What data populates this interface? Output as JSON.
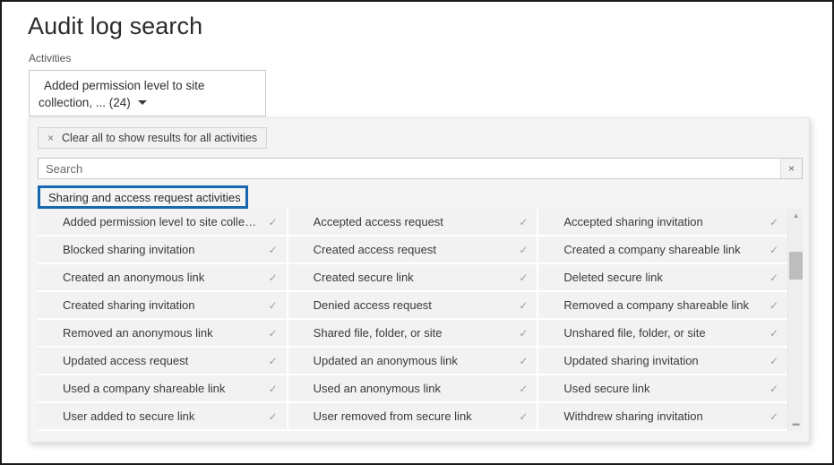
{
  "page": {
    "title": "Audit log search"
  },
  "activities_field": {
    "label": "Activities",
    "selected_line1": "Added permission level to site",
    "selected_line2": "collection, ... (24)",
    "caret_icon": "chevron-down-icon"
  },
  "panel": {
    "clear_all": {
      "x_icon": "close-icon",
      "label": "Clear all to show results for all activities"
    },
    "search": {
      "value": "",
      "placeholder": "Search",
      "clear_icon": "close-icon",
      "clear_label": "×"
    },
    "group_header": {
      "label": "Sharing and access request activities"
    },
    "check_glyph": "✓",
    "columns": [
      [
        {
          "label": "Added permission level to site collection",
          "selected": true
        },
        {
          "label": "Blocked sharing invitation",
          "selected": true
        },
        {
          "label": "Created an anonymous link",
          "selected": true
        },
        {
          "label": "Created sharing invitation",
          "selected": true
        },
        {
          "label": "Removed an anonymous link",
          "selected": true
        },
        {
          "label": "Updated access request",
          "selected": true
        },
        {
          "label": "Used a company shareable link",
          "selected": true
        },
        {
          "label": "User added to secure link",
          "selected": true
        }
      ],
      [
        {
          "label": "Accepted access request",
          "selected": true
        },
        {
          "label": "Created access request",
          "selected": true
        },
        {
          "label": "Created secure link",
          "selected": true
        },
        {
          "label": "Denied access request",
          "selected": true
        },
        {
          "label": "Shared file, folder, or site",
          "selected": true
        },
        {
          "label": "Updated an anonymous link",
          "selected": true
        },
        {
          "label": "Used an anonymous link",
          "selected": true
        },
        {
          "label": "User removed from secure link",
          "selected": true
        }
      ],
      [
        {
          "label": "Accepted sharing invitation",
          "selected": true
        },
        {
          "label": "Created a company shareable link",
          "selected": true
        },
        {
          "label": "Deleted secure link",
          "selected": true
        },
        {
          "label": "Removed a company shareable link",
          "selected": true
        },
        {
          "label": "Unshared file, folder, or site",
          "selected": true
        },
        {
          "label": "Updated sharing invitation",
          "selected": true
        },
        {
          "label": "Used secure link",
          "selected": true
        },
        {
          "label": "Withdrew sharing invitation",
          "selected": true
        }
      ]
    ],
    "scrollbar": {
      "up_icon": "chevron-up-icon",
      "down_icon": "chevron-down-icon",
      "up_glyph": "▲",
      "down_glyph": "▬"
    }
  },
  "colors": {
    "focus_blue": "#1666b0",
    "row_bg": "#f2f2f2",
    "panel_bg": "#f4f4f4"
  }
}
